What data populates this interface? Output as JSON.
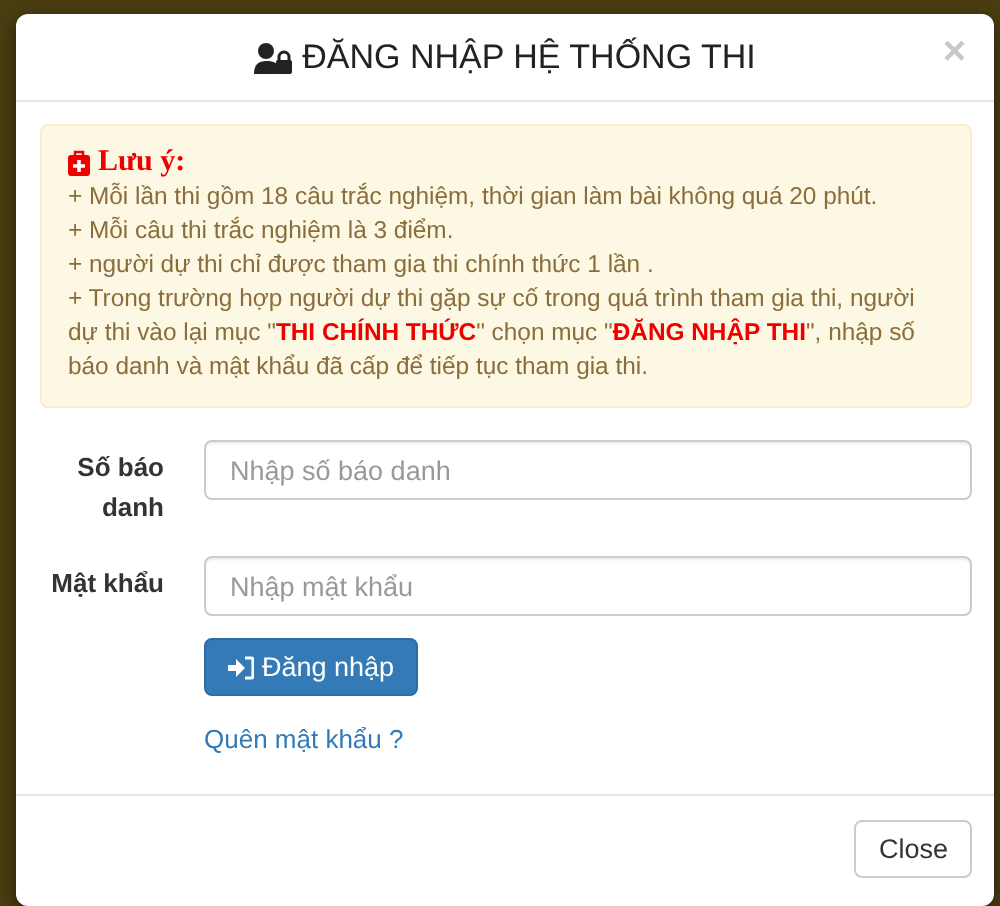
{
  "modal": {
    "title": "ĐĂNG NHẬP HỆ THỐNG THI",
    "close_symbol": "×"
  },
  "notice": {
    "heading": "Lưu ý:",
    "lines": [
      "+ Mỗi lần thi gồm 18 câu trắc nghiệm, thời gian làm bài không quá 20 phút.",
      "+ Mỗi câu thi trắc nghiệm là 3 điểm.",
      "+ người dự thi chỉ được tham gia thi chính thức 1 lần .",
      "+ Trong trường hợp người dự thi gặp sự cố trong quá trình tham gia thi, người dự thi vào lại mục \"**THI CHÍNH THỨC**\" chọn mục \"**ĐĂNG NHẬP THI**\", nhập số báo danh và mật khẩu đã cấp để tiếp tục tham gia thi."
    ]
  },
  "fields": [
    {
      "label": "Số báo danh",
      "placeholder": "Nhập số báo danh"
    },
    {
      "label": "Mật khẩu",
      "placeholder": "Nhập mật khẩu"
    }
  ],
  "submit_button": "Đăng nhập",
  "forgot_link": "Quên mật khẩu ?",
  "close_button": "Close"
}
